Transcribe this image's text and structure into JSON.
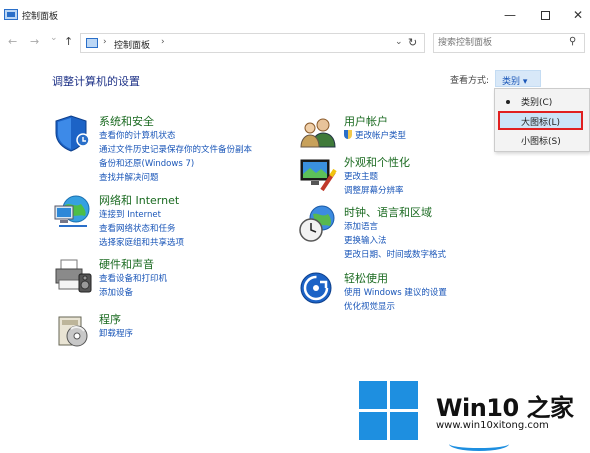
{
  "window": {
    "title": "控制面板",
    "min_glyph": "—",
    "close_glyph": "✕"
  },
  "nav": {
    "back_glyph": "←",
    "forward_glyph": "→",
    "down_glyph": "⌄",
    "up_glyph": "↑",
    "breadcrumb": "控制面板",
    "sep": "›",
    "dropdown_glyph": "⌄",
    "refresh_glyph": "↻",
    "search_placeholder": "搜索控制面板",
    "search_glyph": "⚲"
  },
  "header": {
    "title": "调整计算机的设置",
    "viewby_label": "查看方式:",
    "viewby_value": "类别 ▾"
  },
  "viewby_menu": {
    "items": [
      "类别(C)",
      "大图标(L)",
      "小图标(S)"
    ],
    "selected": "类别(C)",
    "hovered": "大图标(L)"
  },
  "categories": [
    {
      "title": "系统和安全",
      "links": [
        "查看你的计算机状态",
        "通过文件历史记录保存你的文件备份副本",
        "备份和还原(Windows 7)",
        "查找并解决问题"
      ]
    },
    {
      "title": "网络和 Internet",
      "links": [
        "连接到 Internet",
        "查看网络状态和任务",
        "选择家庭组和共享选项"
      ]
    },
    {
      "title": "硬件和声音",
      "links": [
        "查看设备和打印机",
        "添加设备"
      ]
    },
    {
      "title": "程序",
      "links": [
        "卸载程序"
      ]
    },
    {
      "title": "用户帐户",
      "links": [
        "更改帐户类型"
      ]
    },
    {
      "title": "外观和个性化",
      "links": [
        "更改主题",
        "调整屏幕分辨率"
      ]
    },
    {
      "title": "时钟、语言和区域",
      "links": [
        "添加语言",
        "更换输入法",
        "更改日期、时间或数字格式"
      ]
    },
    {
      "title": "轻松使用",
      "links": [
        "使用 Windows 建议的设置",
        "优化视觉显示"
      ]
    }
  ],
  "watermark": {
    "brand": "Win10 之家",
    "url": "www.win10xitong.com"
  },
  "colors": {
    "category_title": "#1a6a20",
    "link": "#1a56b8",
    "heading": "#1e3287",
    "menu_highlight_border": "#e02020",
    "win_logo_blue": "#1e8fe0"
  }
}
